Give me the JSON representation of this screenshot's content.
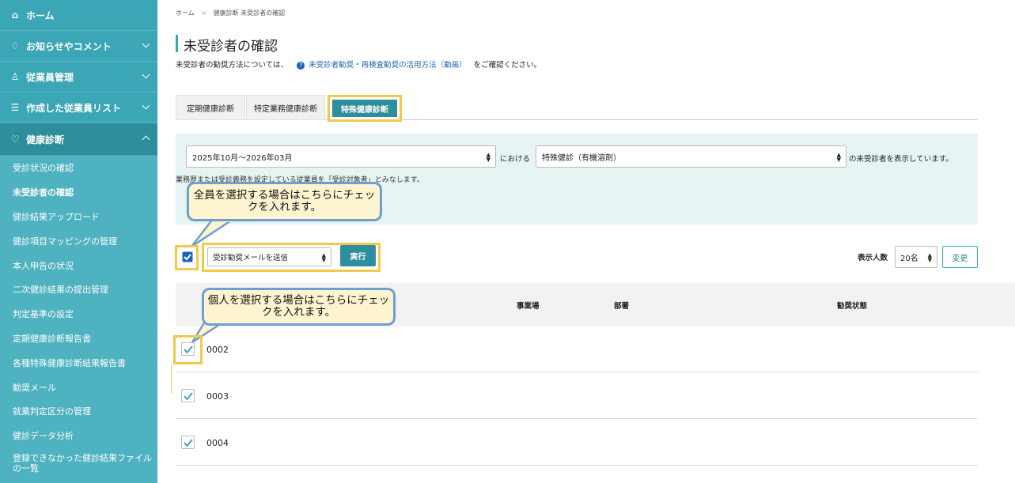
{
  "sidebar": {
    "top_items": [
      {
        "label": "ホーム"
      },
      {
        "label": "お知らせやコメント"
      },
      {
        "label": "従業員管理"
      },
      {
        "label": "作成した従業員リスト"
      },
      {
        "label": "健康診断"
      }
    ],
    "icons": {
      "home": "⌂",
      "bell": "♢",
      "users": "♙",
      "list": "☰",
      "health": "♡"
    },
    "sub_items": [
      {
        "label": "受診状況の確認"
      },
      {
        "label": "未受診者の確認"
      },
      {
        "label": "健診結果アップロード"
      },
      {
        "label": "健診項目マッピングの管理"
      },
      {
        "label": "本人申告の状況"
      },
      {
        "label": "二次健診結果の提出管理"
      },
      {
        "label": "判定基準の設定"
      },
      {
        "label": "定期健康診断報告書"
      },
      {
        "label": "各種特殊健康診断結果報告書"
      },
      {
        "label": "勧奨メール"
      },
      {
        "label": "就業判定区分の管理"
      },
      {
        "label": "健診データ分析"
      },
      {
        "label": "登録できなかった健診結果ファイルの一覧"
      }
    ]
  },
  "breadcrumb": {
    "home": "ホーム",
    "sep": ">",
    "current": "健康診断 未受診者の確認"
  },
  "page": {
    "title": "未受診者の確認",
    "desc_before": "未受診者の勧奨方法については、",
    "desc_link": "未受診者勧奨・再検査勧奨の活用方法（動画）",
    "desc_after": "をご確認ください。",
    "help_icon": "?"
  },
  "tabs": [
    {
      "label": "定期健康診断"
    },
    {
      "label": "特定業務健康診断"
    },
    {
      "label": "特殊健康診断"
    }
  ],
  "filter": {
    "period": "2025年10月～2026年03月",
    "in_text": "における",
    "exam_type": "特殊健診（有機溶剤）",
    "after_text": "の未受診者を表示しています。",
    "note": "業務歴または受診義務を設定している従業員を「受診対象者」とみなします。"
  },
  "callouts": {
    "all": "全員を選択する場合はこちらにチェックを入れます。",
    "individual": "個人を選択する場合はこちらにチェックを入れます。"
  },
  "actions": {
    "action_select": "受診勧奨メールを送信",
    "execute": "実行",
    "display_label": "表示人数",
    "display_count": "20名",
    "change": "変更"
  },
  "table": {
    "headers": {
      "site": "事業場",
      "dept": "部署",
      "status": "勧奨状態"
    },
    "rows": [
      {
        "id": "0002"
      },
      {
        "id": "0003"
      },
      {
        "id": "0004"
      }
    ]
  },
  "colors": {
    "accent": "#3aa6b6",
    "accent_dark": "#2f8e9c",
    "highlight": "#f2c949",
    "callout_border": "#6e9fd2"
  }
}
